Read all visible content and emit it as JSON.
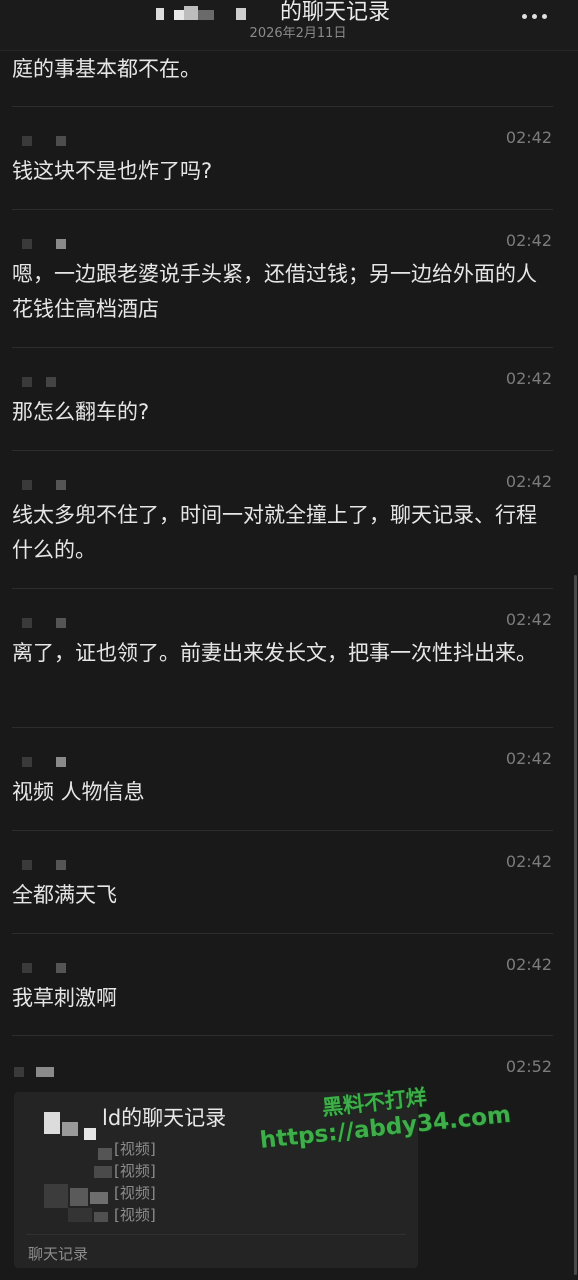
{
  "header": {
    "title": "的聊天记录",
    "date": "2026年2月11日"
  },
  "messages": {
    "first_text": "庭的事基本都不在。",
    "items": [
      {
        "time": "02:42",
        "text": "钱这块不是也炸了吗?"
      },
      {
        "time": "02:42",
        "text": "嗯，一边跟老婆说手头紧，还借过钱；另一边给外面的人花钱住高档酒店"
      },
      {
        "time": "02:42",
        "text": "那怎么翻车的?"
      },
      {
        "time": "02:42",
        "text": "线太多兜不住了，时间一对就全撞上了，聊天记录、行程什么的。"
      },
      {
        "time": "02:42",
        "text": "离了，证也领了。前妻出来发长文，把事一次性抖出来。"
      },
      {
        "time": "02:42",
        "text": "视频 人物信息"
      },
      {
        "time": "02:42",
        "text": "全都满天飞"
      },
      {
        "time": "02:42",
        "text": "我草刺激啊"
      },
      {
        "time": "02:52",
        "text": ""
      }
    ]
  },
  "forward_card": {
    "title": "ld的聊天记录",
    "rows": [
      "[视频]",
      "[视频]",
      "[视频]",
      "[视频]"
    ],
    "footer": "聊天记录"
  },
  "watermark": {
    "brand": "黑料不打烊",
    "url": "https://abdy34.com"
  },
  "colors": {
    "background": "#191919",
    "text": "#e6e6e6",
    "time": "#7c7c7c",
    "watermark": "#3fae4a"
  }
}
